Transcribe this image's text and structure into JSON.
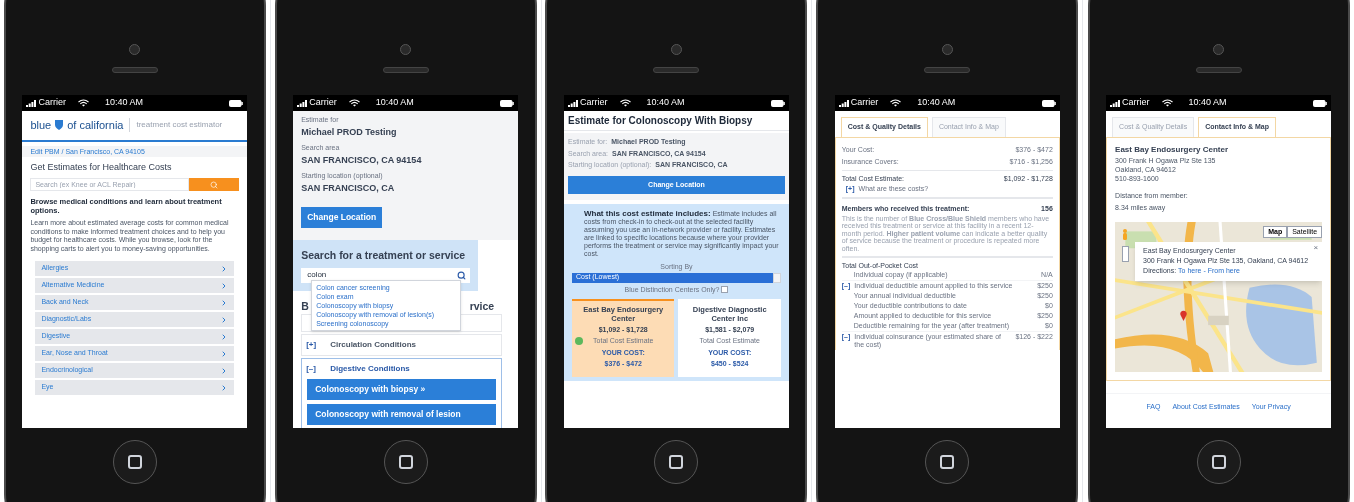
{
  "phones": [
    {
      "kind": "home",
      "status": {
        "carrier": "Carrier",
        "time": "10:40 AM"
      },
      "logo": {
        "brand": "blue",
        "region": "of california",
        "tagline": "treatment cost estimator"
      },
      "location": "Edit PBM / San Francisco, CA 94105",
      "title": "Get Estimates for Healthcare Costs",
      "search": {
        "placeholder": "Search (ex Knee or ACL Repair)"
      },
      "heading": "Browse medical conditions and learn about treatment options.",
      "intro": "Learn more about estimated average costs for common medical conditions to make informed treatment choices and to help you budget for healthcare costs. While you browse, look for the shopping carts to alert you to money-saving opportunities.",
      "categories": [
        "Allergies",
        "Alternative Medicine",
        "Back and Neck",
        "Diagnostic/Labs",
        "Digestive",
        "Ear, Nose and Throat",
        "Endocrinological",
        "Eye"
      ]
    },
    {
      "kind": "search",
      "status": {
        "carrier": "Carrier",
        "time": "10:40 AM"
      },
      "info": [
        {
          "label": "Estimate for",
          "value": "Michael PROD Testing"
        },
        {
          "label": "Search area",
          "value": "SAN FRANCISCO, CA 94154"
        },
        {
          "label": "Starting location (optional)",
          "value": "SAN FRANCISCO, CA"
        }
      ],
      "button": "Change Location",
      "search_title": "Search for a treatment or service",
      "search": {
        "value": "colon"
      },
      "suggestions": [
        "Colon cancer screening",
        "Colon exam",
        "Colonoscopy with biopsy",
        "Colonoscopy with removal of lesion(s)",
        "Screening colonoscopy"
      ],
      "browse_heading": [
        "B",
        "rvice"
      ],
      "accordion": [
        {
          "toggle": "[+]",
          "label": "Circulation Conditions",
          "expanded": false
        },
        {
          "toggle": "[–]",
          "label": "Digestive Conditions",
          "expanded": true,
          "children": [
            "Colonoscopy with biopsy »",
            "Colonoscopy with removal of lesion"
          ]
        }
      ]
    },
    {
      "kind": "estimate",
      "status": {
        "carrier": "Carrier",
        "time": "10:40 AM"
      },
      "title": "Estimate for Colonoscopy With Biopsy",
      "info": [
        {
          "label": "Estimate for:",
          "value": "Michael PROD Testing"
        },
        {
          "label": "Search area:",
          "value": "SAN FRANCISCO, CA 94154"
        },
        {
          "label": "Starting location (optional):",
          "value": "SAN FRANCISCO, CA"
        }
      ],
      "button": "Change Location",
      "includes": "**What this cost estimate includes:** Estimate includes all costs from check-in to check-out at the selected facility assuming you use an in-network provider or facility. Estimates are linked to specific locations because where your provider performs the treatment or service may significantly impact your cost.",
      "sort_label": "Sorting By",
      "sort_value": "Cost (Lowest)",
      "filter": {
        "label": "Blue Distinction Centers Only?",
        "checked": false
      },
      "cards": [
        {
          "name": "East Bay Endosurgery Center",
          "range": "$1,092 - $1,728",
          "range_label": "Total Cost Estimate",
          "cost_label": "YOUR COST:",
          "cost": "$376 - $472",
          "selected": true,
          "badge": true
        },
        {
          "name": "Digestive Diagnostic Center Inc",
          "range": "$1,581 - $2,079",
          "range_label": "Total Cost Estimate",
          "cost_label": "YOUR COST:",
          "cost": "$450 - $524",
          "selected": false,
          "badge": false
        }
      ]
    },
    {
      "kind": "details",
      "status": {
        "carrier": "Carrier",
        "time": "10:40 AM"
      },
      "tabs": [
        {
          "label": "Cost & Quality Details",
          "selected": true
        },
        {
          "label": "Contact Info & Map",
          "selected": false
        }
      ],
      "costs": [
        {
          "label": "Your Cost:",
          "value": "$376 - $472"
        },
        {
          "label": "Insurance Covers:",
          "value": "$716 - $1,256"
        }
      ],
      "total": {
        "label": "Total Cost Estimate:",
        "value": "$1,092 - $1,728"
      },
      "what": {
        "toggle": "[+]",
        "label": "What are these costs?"
      },
      "members": {
        "label": "Members who received this treatment:",
        "value": "156",
        "note": "This is the number of **Blue Cross/Blue Shield** members who have received this treatment or service at this facility in a recent 12-month period. **Higher patient volume** can indicate a better quality of service because the treatment or procedure is repeated more often."
      },
      "oop_title": "Total Out-of-Pocket Cost",
      "oop": [
        {
          "kind": "plain",
          "label": "Individual copay (if applicable)",
          "value": "N/A"
        },
        {
          "kind": "toggle",
          "toggle": "[–]",
          "label": "Individual deductible amount applied to this service",
          "value": "$250"
        },
        {
          "kind": "sub",
          "label": "Your annual individual deductible",
          "value": "$250"
        },
        {
          "kind": "sub",
          "label": "Your deductible contributions to date",
          "value": "$0"
        },
        {
          "kind": "sub",
          "label": "Amount applied to deductible for this service",
          "value": "$250"
        },
        {
          "kind": "sub",
          "label": "Deductible remaining for the year (after treatment)",
          "value": "$0"
        },
        {
          "kind": "toggle",
          "toggle": "[–]",
          "label": "Individual coinsurance (your estimated share of the cost)",
          "value": "$126 - $222"
        }
      ]
    },
    {
      "kind": "contact",
      "status": {
        "carrier": "Carrier",
        "time": "10:40 AM"
      },
      "tabs": [
        {
          "label": "Cost & Quality Details",
          "selected": false
        },
        {
          "label": "Contact Info & Map",
          "selected": true
        }
      ],
      "name": "East Bay Endosurgery Center",
      "address": [
        "300 Frank H Ogawa Plz Ste 135",
        "Oakland, CA 94612",
        "510-893-1600"
      ],
      "distance_label": "Distance from member:",
      "distance": "8.34 miles away",
      "map": {
        "kind": "picture",
        "types": [
          "Map",
          "Satellite"
        ],
        "close": "×",
        "popup": {
          "name": "East Bay Endosurgery Center",
          "address": "300 Frank H Ogawa Plz Ste 135, Oakland, CA 94612",
          "directions": "Directions:",
          "links": [
            "To here",
            "From here"
          ],
          "separator": " - "
        }
      },
      "footer": [
        "FAQ",
        "About Cost Estimates",
        "Your Privacy"
      ]
    }
  ]
}
